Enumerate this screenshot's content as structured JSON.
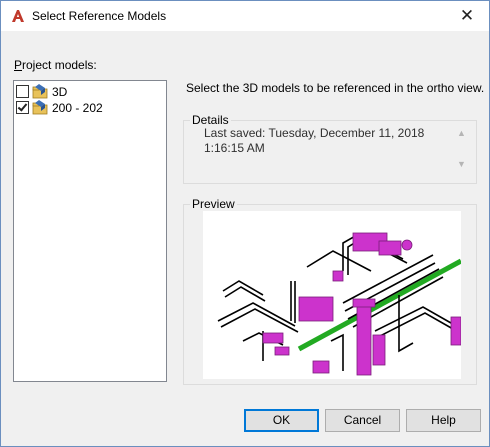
{
  "window": {
    "title": "Select Reference Models",
    "close_glyph": "✕",
    "icon": "autocad-a-icon",
    "accent_color": "#c0392b"
  },
  "project_models": {
    "label_underlined": "P",
    "label_rest": "roject models:",
    "items": [
      {
        "label": "3D",
        "checked": false,
        "icon": "model-folder-icon"
      },
      {
        "label": "200 - 202",
        "checked": true,
        "icon": "model-folder-icon"
      }
    ]
  },
  "instruction": "Select the 3D models to be referenced in the ortho view.",
  "details": {
    "label": "Details",
    "text": "Last saved: Tuesday, December 11, 2018 1:16:15 AM"
  },
  "preview": {
    "label": "Preview",
    "colors": {
      "pipe": "#000000",
      "equipment": "#cc33cc",
      "line": "#22aa22"
    }
  },
  "buttons": {
    "ok": "OK",
    "cancel": "Cancel",
    "help": "Help"
  }
}
